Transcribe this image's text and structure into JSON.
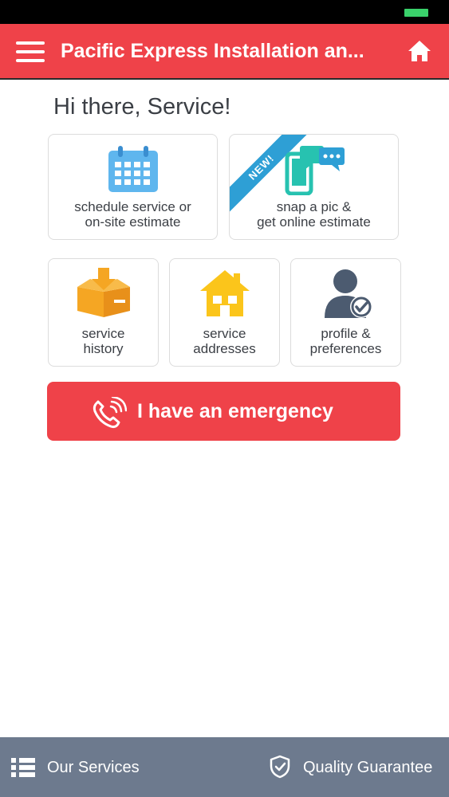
{
  "header": {
    "title": "Pacific Express Installation an...",
    "menu_icon": "hamburger-menu-icon",
    "home_icon": "home-icon",
    "color": "#ef4249"
  },
  "greeting": "Hi there, Service!",
  "tiles": [
    {
      "label": "schedule service or\non-site estimate",
      "icon": "calendar-icon"
    },
    {
      "label": "snap a pic &\nget online estimate",
      "icon": "phone-chat-icon",
      "badge": "NEW!"
    },
    {
      "label": "service\nhistory",
      "icon": "box-download-icon"
    },
    {
      "label": "service\naddresses",
      "icon": "house-icon"
    },
    {
      "label": "profile &\npreferences",
      "icon": "user-check-icon"
    }
  ],
  "emergency": {
    "label": "I have an emergency",
    "icon": "phone-ringing-icon",
    "color": "#ef4249"
  },
  "bottom_nav": {
    "services_label": "Our Services",
    "guarantee_label": "Quality Guarantee",
    "color": "#6d7a8e"
  }
}
